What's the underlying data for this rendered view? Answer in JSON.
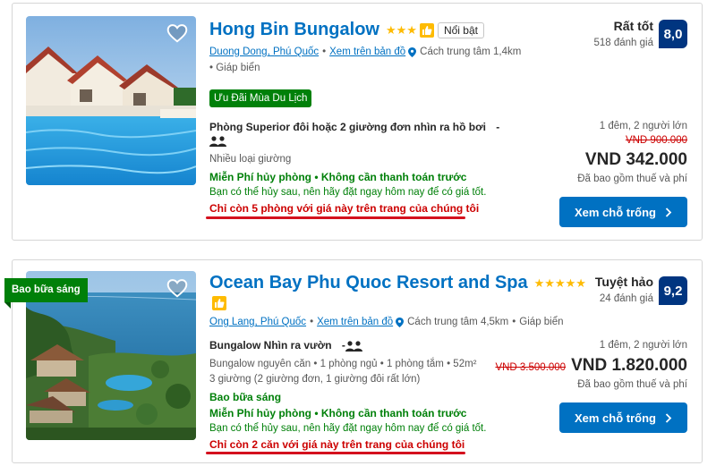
{
  "colors": {
    "link": "#0071c2",
    "green": "#008009",
    "red": "#cc0000",
    "badge": "#003580",
    "star": "#febb02"
  },
  "hotels": [
    {
      "name": "Hong Bin Bungalow",
      "stars": "★★★",
      "featured_label": "Nổi bật",
      "location_link": "Duong Dong, Phú Quốc",
      "map_link": "Xem trên bản đồ",
      "distance": "Cách trung tâm 1,4km",
      "feature": "Giáp biển",
      "deal_label": "Ưu Đãi Mùa Du Lịch",
      "room_type": "Phòng Superior đôi hoặc 2 giường đơn nhìn ra hồ bơi",
      "room_dash": "-",
      "bed_info": "Nhiều loại giường",
      "cancellation": "Miễn Phí hủy phòng • Không cần thanh toán trước",
      "cancel_note": "Bạn có thể hủy sau, nên hãy đặt ngay hôm nay để có giá tốt.",
      "scarcity": "Chỉ còn 5 phòng với giá này trên trang của chúng tôi",
      "score_word": "Rất tốt",
      "review_count": "518 đánh giá",
      "score": "8,0",
      "nights_guests": "1 đêm, 2 người lớn",
      "old_price": "VND 900.000",
      "price": "VND 342.000",
      "taxes": "Đã bao gồm thuế và phí",
      "cta": "Xem chỗ trống",
      "icons": [
        "heart-icon",
        "star-icon",
        "thumbs-up-icon",
        "map-pin-icon",
        "people-icon",
        "chevron-right-icon"
      ]
    },
    {
      "name": "Ocean Bay Phu Quoc Resort and Spa",
      "stars": "★★★★★",
      "ribbon": "Bao bữa sáng",
      "location_link": "Ong Lang, Phú Quốc",
      "map_link": "Xem trên bản đồ",
      "distance": "Cách trung tâm 4,5km",
      "feature": "Giáp biển",
      "room_type": "Bungalow Nhìn ra vườn",
      "room_dash": "-",
      "room_detail": "Bungalow nguyên căn • 1 phòng ngủ • 1 phòng tắm • 52m²",
      "bed_info": "3 giường (2 giường đơn, 1 giường đôi rất lớn)",
      "breakfast": "Bao bữa sáng",
      "cancellation": "Miễn Phí hủy phòng • Không cần thanh toán trước",
      "cancel_note": "Bạn có thể hủy sau, nên hãy đặt ngay hôm nay để có giá tốt.",
      "scarcity": "Chỉ còn 2 căn với giá này trên trang của chúng tôi",
      "score_word": "Tuyệt hảo",
      "review_count": "24 đánh giá",
      "score": "9,2",
      "nights_guests": "1 đêm, 2 người lớn",
      "old_price": "VND 3.500.000",
      "price": "VND 1.820.000",
      "taxes": "Đã bao gồm thuế và phí",
      "cta": "Xem chỗ trống"
    }
  ]
}
